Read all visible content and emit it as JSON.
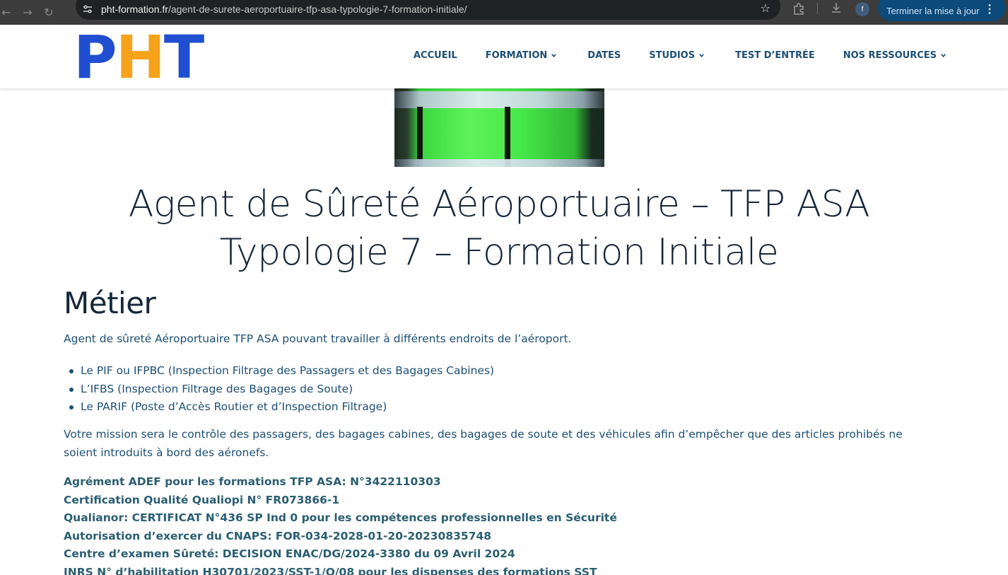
{
  "browser": {
    "url_host": "pht-formation.fr",
    "url_path": "/agent-de-surete-aeroportuaire-tfp-asa-typologie-7-formation-initiale/",
    "profile_initial": "f",
    "update_button_label": "Terminer la mise à jour",
    "icons": [
      "back-arrow-icon",
      "forward-arrow-icon",
      "reload-icon",
      "site-info-icon",
      "bookmark-star-icon",
      "extensions-icon",
      "download-icon",
      "menu-kebab-icon"
    ]
  },
  "header": {
    "logo": {
      "letters": [
        "P",
        "H",
        "T"
      ],
      "colors": {
        "P": "#1f4fd0",
        "H": "#f7a21b",
        "T": "#1f4fd0"
      }
    },
    "nav": [
      {
        "label": "ACCUEIL",
        "has_dropdown": false
      },
      {
        "label": "FORMATION",
        "has_dropdown": true
      },
      {
        "label": "DATES",
        "has_dropdown": false
      },
      {
        "label": "STUDIOS",
        "has_dropdown": true
      },
      {
        "label": "TEST D’ENTRÉE",
        "has_dropdown": false
      },
      {
        "label": "NOS RESSOURCES",
        "has_dropdown": true
      }
    ]
  },
  "content": {
    "title_line1": "Agent de Sûreté Aéroportuaire – TFP ASA",
    "title_line2": "Typologie 7 – Formation Initiale",
    "section_title": "Métier",
    "intro": "Agent de sûreté Aéroportuaire TFP ASA pouvant travailler à différents endroits de l’aéroport.",
    "bullets": [
      "Le PIF ou IFPBC (Inspection Filtrage des Passagers et des Bagages Cabines)",
      "L’IFBS (Inspection Filtrage des Bagages de Soute)",
      "Le PARIF (Poste d’Accès Routier et d’Inspection Filtrage)"
    ],
    "mission": "Votre mission sera le contrôle des passagers, des bagages cabines, des bagages de soute et des véhicules afin d’empêcher que des articles prohibés ne soient introduits à bord des aéronefs.",
    "credentials": [
      "Agrément ADEF pour les formations TFP ASA: N°3422110303",
      "Certification Qualité Qualiopi N° FR073866-1",
      "Qualianor: CERTIFICAT N°436 SP Ind 0 pour les compétences professionnelles en Sécurité",
      "Autorisation d’exercer du CNAPS: FOR-034-2028-01-20-20230835748",
      "Centre d’examen Sûreté: DECISION ENAC/DG/2024-3380 du 09 Avril 2024",
      "INRS N° d’habilitation H30701/2023/SST-1/O/08 pour les dispenses des formations SST"
    ]
  },
  "colors": {
    "accent_text": "#1d4f74",
    "title": "#17273a",
    "credentials": "#2b5e72",
    "update_button": "#0b4a7a"
  }
}
